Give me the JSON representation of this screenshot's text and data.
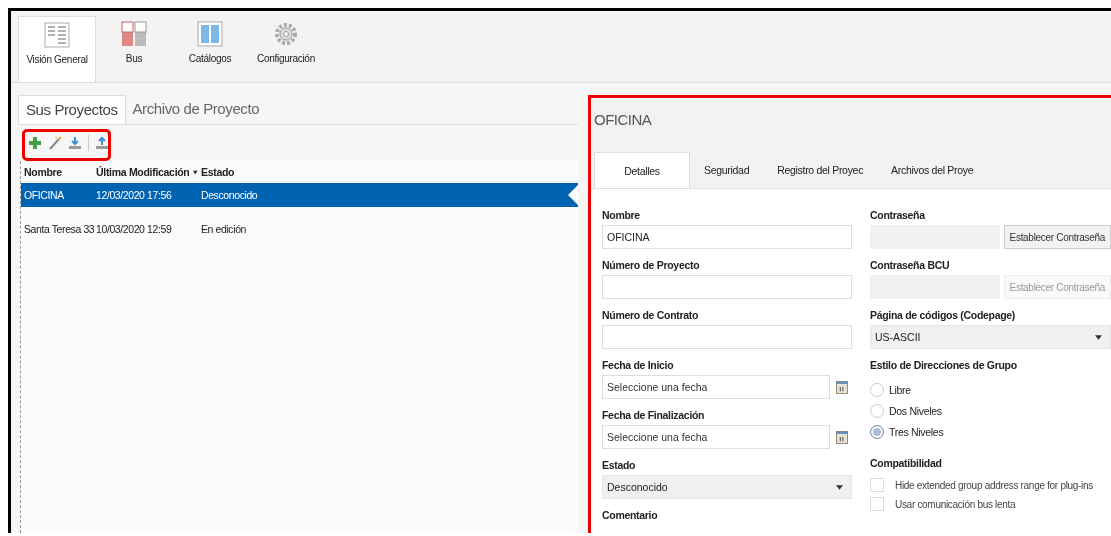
{
  "ribbon_tabs": [
    {
      "label": "Visión General",
      "kind": "overview",
      "selected": true
    },
    {
      "label": "Bus",
      "kind": "bus",
      "selected": false
    },
    {
      "label": "Catálogos",
      "kind": "catalog",
      "selected": false
    },
    {
      "label": "Configuración",
      "kind": "settings",
      "selected": false
    }
  ],
  "project_tabs": [
    {
      "label": "Sus Proyectos",
      "selected": true
    },
    {
      "label": "Archivo de Proyecto",
      "selected": false
    }
  ],
  "table": {
    "columns": [
      {
        "label": "Nombre",
        "sorted": false
      },
      {
        "label": "Última Modificación",
        "sorted": true
      },
      {
        "label": "Estado",
        "sorted": false
      }
    ],
    "rows": [
      {
        "cells": [
          "OFICINA",
          "12/03/2020 17:56",
          "Desconocido"
        ],
        "selected": true
      },
      {
        "cells": [
          "Santa Teresa 33",
          "10/03/2020 12:59",
          "En edición"
        ],
        "selected": false
      }
    ]
  },
  "details": {
    "title": "OFICINA",
    "tabs": [
      {
        "label": "Detalles",
        "selected": true
      },
      {
        "label": "Seguridad",
        "selected": false
      },
      {
        "label": "Registro del Proyec",
        "selected": false
      },
      {
        "label": "Archivos del Proye",
        "selected": false
      }
    ],
    "left_fields": [
      {
        "kind": "text",
        "label": "Nombre",
        "value": "OFICINA"
      },
      {
        "kind": "text",
        "label": "Número de Proyecto"
      },
      {
        "kind": "text",
        "label": "Número de Contrato"
      },
      {
        "kind": "date",
        "label": "Fecha de Inicio",
        "placeholder": "Seleccione una fecha"
      },
      {
        "kind": "date",
        "label": "Fecha de Finalización",
        "placeholder": "Seleccione una fecha"
      },
      {
        "kind": "select",
        "label": "Estado",
        "value": "Desconocido"
      },
      {
        "kind": "heading",
        "label": "Comentario"
      }
    ],
    "passwords": [
      {
        "label": "Contraseña",
        "button": "Establecer Contraseña",
        "disabled": false
      },
      {
        "label": "Contraseña BCU",
        "button": "Establecer Contraseña",
        "disabled": true
      }
    ],
    "codepage": {
      "label": "Página de códigos (Codepage)",
      "value": "US-ASCII"
    },
    "group_address_style": {
      "label": "Estilo de Direcciones de Grupo",
      "options": [
        {
          "label": "Libre",
          "selected": false
        },
        {
          "label": "Dos Niveles",
          "selected": false
        },
        {
          "label": "Tres Niveles",
          "selected": true
        }
      ]
    },
    "compatibility": {
      "label": "Compatibilidad",
      "options": [
        {
          "label": "Hide extended group address range for plug-ins",
          "checked": false
        },
        {
          "label": "Usar comunicación bus lenta",
          "checked": false
        }
      ]
    }
  }
}
